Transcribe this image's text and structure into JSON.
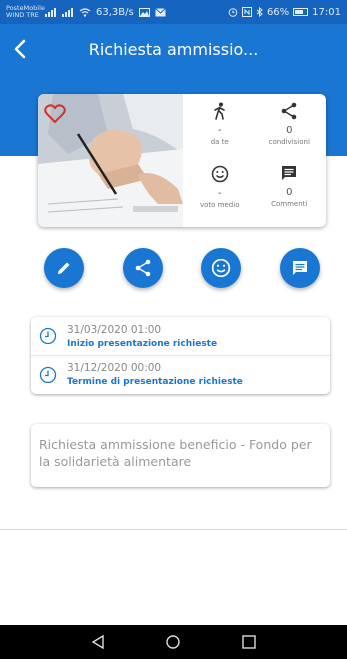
{
  "status_bar": {
    "carrier_line1": "PosteMobile",
    "carrier_line2": "WIND TRE",
    "speed": "63,3B/s",
    "battery": "66%",
    "time": "17:01"
  },
  "header": {
    "title": "Richiesta ammissio..."
  },
  "card": {
    "stats": [
      {
        "icon": "walking-person-icon",
        "value": "-",
        "label": "da te"
      },
      {
        "icon": "share-icon",
        "value": "0",
        "label": "condivisioni"
      },
      {
        "icon": "smiley-icon",
        "value": "-",
        "label": "voto medio"
      },
      {
        "icon": "comment-icon",
        "value": "0",
        "label": "Commenti"
      }
    ]
  },
  "actions": [
    "edit",
    "share",
    "rate",
    "comment"
  ],
  "dates": [
    {
      "time": "31/03/2020 01:00",
      "label": "Inizio presentazione richieste"
    },
    {
      "time": "31/12/2020 00:00",
      "label": "Termine di presentazione richieste"
    }
  ],
  "description": "Richiesta ammissione beneficio - Fondo per la solidarietà alimentare",
  "colors": {
    "primary": "#1976d2",
    "status_bar": "#1565c0",
    "heart": "#d32f2f"
  }
}
